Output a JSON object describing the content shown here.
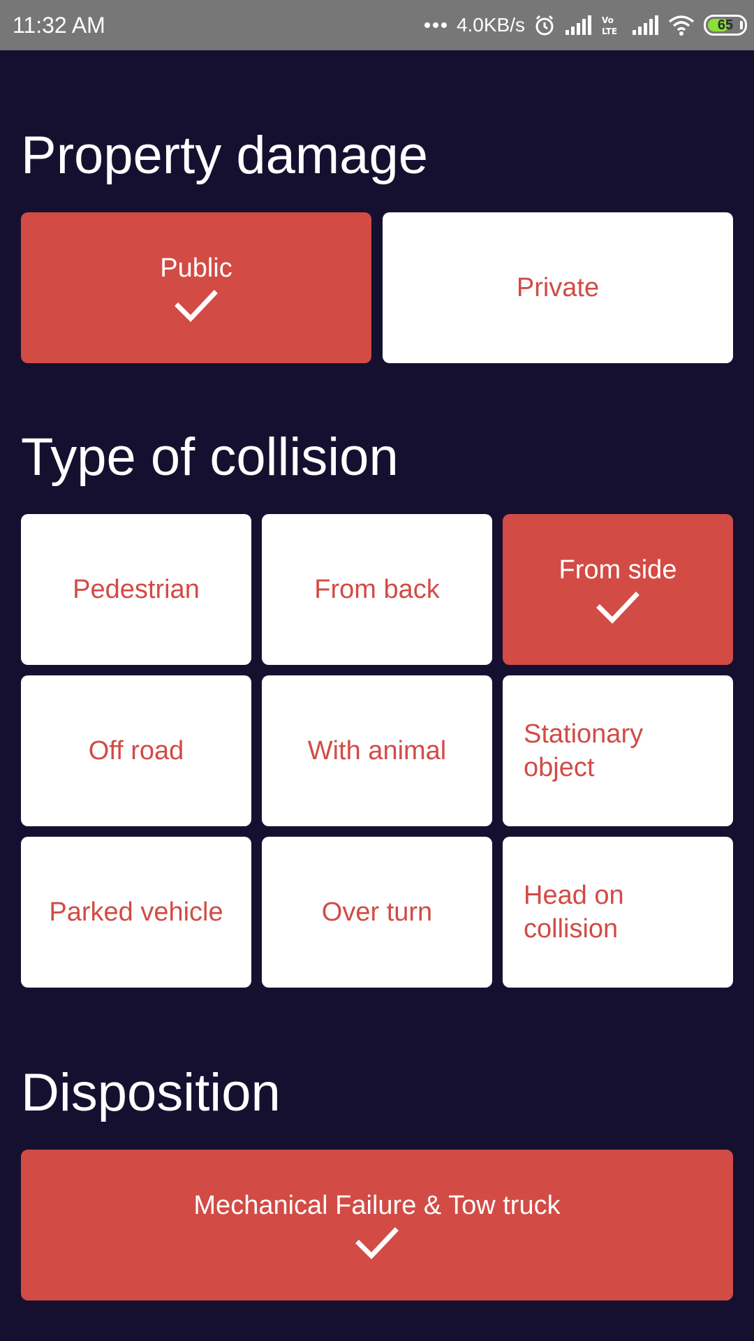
{
  "status_bar": {
    "time": "11:32 AM",
    "speed": "4.0KB/s",
    "battery": "65",
    "battery_level": 0.65,
    "icons": [
      "more-dots-icon",
      "alarm-icon",
      "signal-icon",
      "volte-icon",
      "signal-icon",
      "wifi-icon",
      "battery-icon"
    ]
  },
  "property_damage": {
    "title": "Property damage",
    "options": [
      {
        "label": "Public",
        "selected": true
      },
      {
        "label": "Private",
        "selected": false
      }
    ]
  },
  "collision": {
    "title": "Type of collision",
    "options": [
      {
        "label": "Pedestrian",
        "selected": false
      },
      {
        "label": "From back",
        "selected": false
      },
      {
        "label": "From side",
        "selected": true
      },
      {
        "label": "Off road",
        "selected": false
      },
      {
        "label": "With animal",
        "selected": false
      },
      {
        "label": "Stationary object",
        "selected": false
      },
      {
        "label": "Parked vehicle",
        "selected": false
      },
      {
        "label": "Over turn",
        "selected": false
      },
      {
        "label": "Head on collision",
        "selected": false
      }
    ]
  },
  "disposition": {
    "title": "Disposition",
    "options": [
      {
        "label": "Mechanical Failure & Tow truck",
        "selected": true
      }
    ]
  },
  "colors": {
    "background": "#161030",
    "accent": "#d24b45",
    "card": "#ffffff",
    "status_bar": "#777777"
  }
}
